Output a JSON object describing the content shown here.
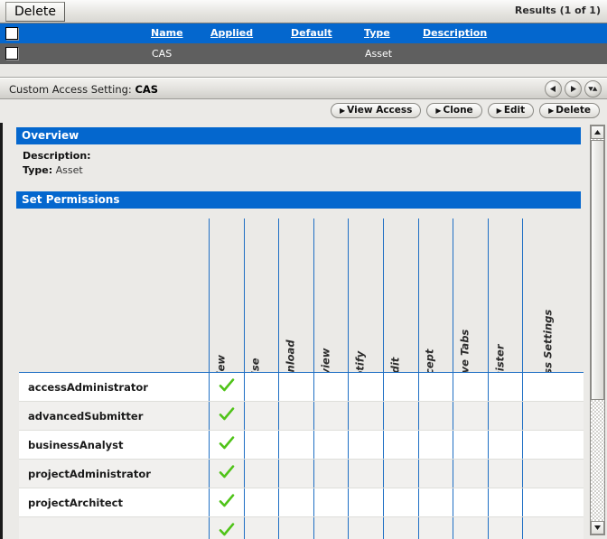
{
  "toolbar": {
    "delete_label": "Delete",
    "results_label": "Results (1 of 1)"
  },
  "results_grid": {
    "columns": [
      "Name",
      "Applied",
      "Default",
      "Type",
      "Description"
    ],
    "rows": [
      {
        "name": "CAS",
        "applied": "",
        "default": "",
        "type": "Asset",
        "description": ""
      }
    ]
  },
  "detail": {
    "title_prefix": "Custom Access Setting:",
    "title_value": "CAS",
    "nav": {
      "prev": "previous-record",
      "next": "next-record",
      "updown": "up-down-record"
    },
    "actions": [
      {
        "label": "View Access"
      },
      {
        "label": "Clone"
      },
      {
        "label": "Edit"
      },
      {
        "label": "Delete"
      }
    ]
  },
  "overview": {
    "section_title": "Overview",
    "description_key": "Description:",
    "description_value": "",
    "type_key": "Type:",
    "type_value": "Asset"
  },
  "permissions": {
    "section_title": "Set Permissions",
    "columns": [
      "View",
      "Use",
      "Download",
      "Review",
      "Notify",
      "Edit",
      "Accept",
      "Approve Tabs",
      "Register",
      "Edit Access Settings"
    ],
    "rows": [
      {
        "role": "accessAdministrator",
        "granted": [
          true,
          false,
          false,
          false,
          false,
          false,
          false,
          false,
          false,
          false
        ]
      },
      {
        "role": "advancedSubmitter",
        "granted": [
          true,
          false,
          false,
          false,
          false,
          false,
          false,
          false,
          false,
          false
        ]
      },
      {
        "role": "businessAnalyst",
        "granted": [
          true,
          false,
          false,
          false,
          false,
          false,
          false,
          false,
          false,
          false
        ]
      },
      {
        "role": "projectAdministrator",
        "granted": [
          true,
          false,
          false,
          false,
          false,
          false,
          false,
          false,
          false,
          false
        ]
      },
      {
        "role": "projectArchitect",
        "granted": [
          true,
          false,
          false,
          false,
          false,
          false,
          false,
          false,
          false,
          false
        ]
      },
      {
        "role": "",
        "granted": [
          true,
          false,
          false,
          false,
          false,
          false,
          false,
          false,
          false,
          false
        ]
      }
    ]
  },
  "colors": {
    "header_blue": "#0467ce",
    "selected_row_gray": "#5f5f5f",
    "grid_line_blue": "#1f6fc4",
    "check_green": "#4fc318",
    "panel_bg": "#ebeae7"
  }
}
